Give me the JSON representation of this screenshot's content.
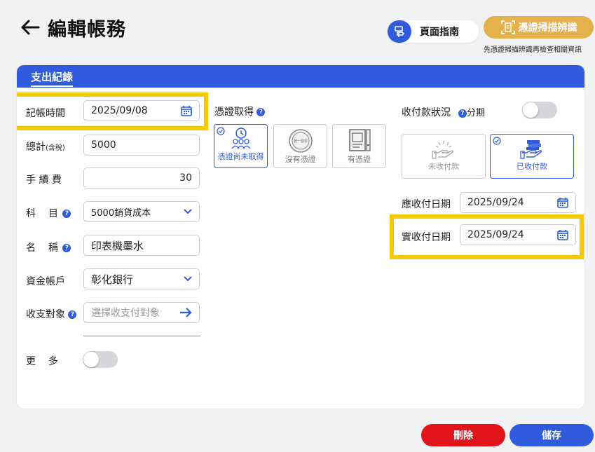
{
  "header": {
    "title": "編輯帳務",
    "guide_label": "頁面指南",
    "scan_label": "憑證掃描辨識",
    "scan_hint": "先憑證掃描辨識再檢查相關資訊"
  },
  "card": {
    "tab_label": "支出紀錄"
  },
  "form": {
    "date_label": "記帳時間",
    "date_value": "2025/09/08",
    "total_label": "總計",
    "total_suffix": "(含稅)",
    "total_value": "5000",
    "fee_label": "手 續 費",
    "fee_value": "30",
    "subject_label": "科　目",
    "subject_value": "5000銷貨成本",
    "name_label": "名　稱",
    "name_value": "印表機墨水",
    "account_label": "資金帳戶",
    "account_value": "彰化銀行",
    "party_label": "收支對象",
    "party_placeholder": "選擇收支付對象",
    "more_label": "更　多"
  },
  "voucher": {
    "label": "憑證取得",
    "options": [
      {
        "label": "憑證尚未取得",
        "selected": true,
        "icon": "clock-people-icon"
      },
      {
        "label": "沒有憑證",
        "selected": false,
        "icon": "stamp-icon"
      },
      {
        "label": "有憑證",
        "selected": false,
        "icon": "receipt-icon"
      }
    ],
    "stamp_text": "統一發票"
  },
  "payment": {
    "status_label": "收付款狀況",
    "installment_label": "分期",
    "unpaid_label": "未收付款",
    "paid_label": "已收付款",
    "due_date_label": "應收付日期",
    "due_date_value": "2025/09/24",
    "actual_date_label": "實收付日期",
    "actual_date_value": "2025/09/24"
  },
  "actions": {
    "delete_label": "刪除",
    "save_label": "儲存"
  },
  "colors": {
    "primary": "#2f5bdc",
    "scan": "#e4b24c",
    "delete": "#e0151b",
    "highlight": "#f7c900"
  }
}
